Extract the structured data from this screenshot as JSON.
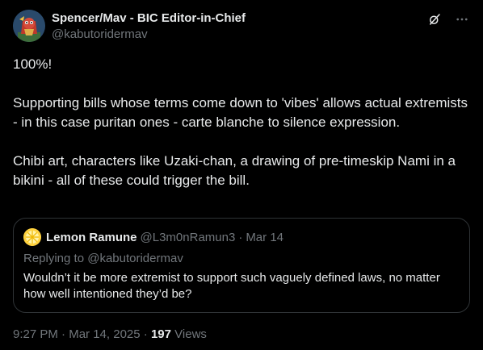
{
  "tweet": {
    "display_name": "Spencer/Mav - BIC Editor-in-Chief",
    "handle": "@kabutoridermav",
    "text": "100%!\n\nSupporting bills whose terms come down to 'vibes' allows actual extremists - in this case puritan ones - carte blanche to silence expression.\n\nChibi art, characters like Uzaki-chan, a drawing of pre-timeskip Nami in a bikini - all of these could trigger the bill.",
    "time": "9:27 PM",
    "date": "Mar 14, 2025",
    "views_count": "197",
    "views_label": "Views",
    "dot": " · "
  },
  "quote": {
    "display_name": "Lemon Ramune",
    "handle": "@L3m0nRamun3",
    "separator": "·",
    "date": "Mar 14",
    "replying_to": "Replying to @kabutoridermav",
    "text": "Wouldn’t it be more extremist to support such vaguely defined laws, no matter how well intentioned they’d be?"
  },
  "icons": {
    "grok": "grok-icon",
    "more": "more-icon",
    "avatar": "avatar-image",
    "quote_avatar": "lemon-avatar-image"
  },
  "colors": {
    "background": "#000000",
    "text": "#e7e9ea",
    "secondary": "#71767b",
    "border": "#2f3336",
    "lemon": "#ffd23f"
  }
}
